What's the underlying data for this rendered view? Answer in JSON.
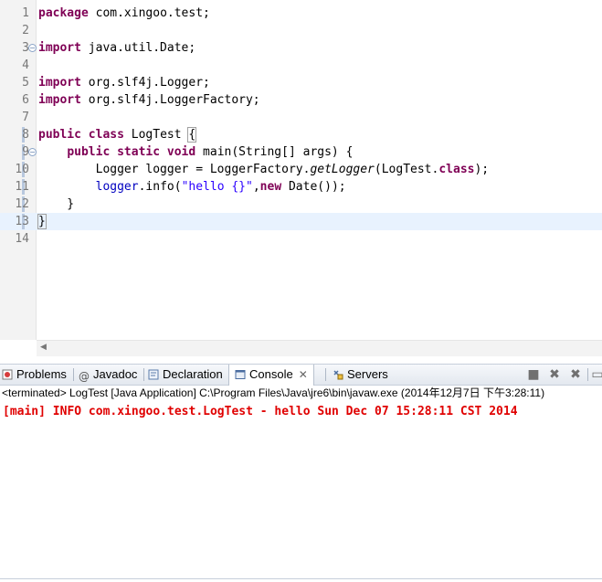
{
  "editor": {
    "lines": [
      {
        "num": "1",
        "code": "package com.xingoo.test;"
      },
      {
        "num": "2",
        "code": ""
      },
      {
        "num": "3",
        "code": "import java.util.Date;"
      },
      {
        "num": "4",
        "code": ""
      },
      {
        "num": "5",
        "code": "import org.slf4j.Logger;"
      },
      {
        "num": "6",
        "code": "import org.slf4j.LoggerFactory;"
      },
      {
        "num": "7",
        "code": ""
      },
      {
        "num": "8",
        "code": "public class LogTest {"
      },
      {
        "num": "9",
        "code": "    public static void main(String[] args) {"
      },
      {
        "num": "10",
        "code": "        Logger logger = LoggerFactory.getLogger(LogTest.class);"
      },
      {
        "num": "11",
        "code": "        logger.info(\"hello {}\",new Date());"
      },
      {
        "num": "12",
        "code": "    }"
      },
      {
        "num": "13",
        "code": "}"
      },
      {
        "num": "14",
        "code": ""
      }
    ],
    "tokens": {
      "package": "package",
      "import": "import",
      "public": "public",
      "class": "class",
      "static": "static",
      "void": "void",
      "new": "new",
      "class_lit": "class",
      "pkg_name": " com.xingoo.test;",
      "imp1": " java.util.Date;",
      "imp2": " org.slf4j.Logger;",
      "imp3": " org.slf4j.LoggerFactory;",
      "class_name": " LogTest ",
      "brace_open": "{",
      "main_sig": " main(String[] args) {",
      "logger_decl_a": "        Logger ",
      "logger_var": "logger",
      "logger_decl_b": " = LoggerFactory.",
      "get_logger": "getLogger",
      "logger_decl_c": "(LogTest.",
      "logger_decl_d": ");",
      "indent4": "    ",
      "indent8": "        ",
      "info_call_a": ".info(",
      "hello_str": "\"hello {}\"",
      "info_call_b": ",",
      "info_call_c": " Date());",
      "close_inner": "    }",
      "close_outer": "}"
    }
  },
  "panel": {
    "tabs": [
      {
        "label": "Problems",
        "icon": "problems-icon"
      },
      {
        "label": "Javadoc",
        "icon": "at-icon"
      },
      {
        "label": "Declaration",
        "icon": "declaration-icon"
      },
      {
        "label": "Console",
        "icon": "console-icon",
        "active": true
      },
      {
        "label": "Servers",
        "icon": "servers-icon"
      }
    ],
    "status_text": "<terminated> LogTest [Java Application] C:\\Program Files\\Java\\jre6\\bin\\javaw.exe (2014年12月7日 下午3:28:11)",
    "console_output": "[main] INFO com.xingoo.test.LogTest - hello Sun Dec 07 15:28:11 CST 2014"
  },
  "colors": {
    "keyword": "#7f0055",
    "string": "#2a00ff",
    "field": "#0000c0",
    "console_error": "#e00000",
    "current_line": "#e8f2fe"
  }
}
